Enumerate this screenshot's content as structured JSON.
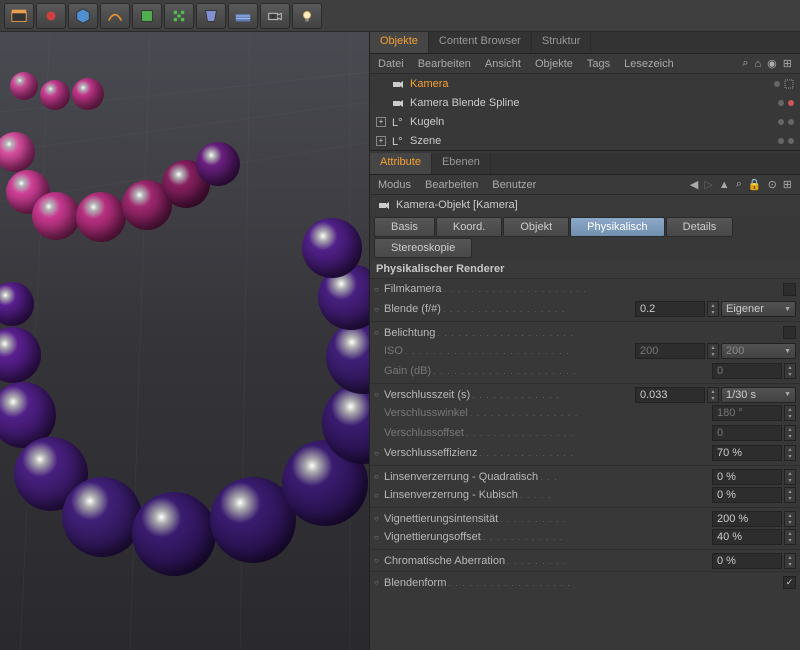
{
  "topTabs": {
    "t1": "Objekte",
    "t2": "Content Browser",
    "t3": "Struktur"
  },
  "menu1": {
    "m1": "Datei",
    "m2": "Bearbeiten",
    "m3": "Ansicht",
    "m4": "Objekte",
    "m5": "Tags",
    "m6": "Lesezeich"
  },
  "objects": {
    "o1": "Kamera",
    "o2": "Kamera Blende Spline",
    "o3": "Kugeln",
    "o4": "Szene"
  },
  "attrTabs": {
    "a1": "Attribute",
    "a2": "Ebenen"
  },
  "menu2": {
    "m1": "Modus",
    "m2": "Bearbeiten",
    "m3": "Benutzer"
  },
  "objTitle": "Kamera-Objekt [Kamera]",
  "btabs": {
    "b1": "Basis",
    "b2": "Koord.",
    "b3": "Objekt",
    "b4": "Physikalisch",
    "b5": "Details",
    "b6": "Stereoskopie"
  },
  "groupTitle": "Physikalischer Renderer",
  "p": {
    "filmkamera": "Filmkamera",
    "blende": "Blende (f/#)",
    "blendeV": "0.2",
    "blendeD": "Eigener",
    "belichtung": "Belichtung",
    "iso": "ISO",
    "isoV": "200",
    "isoD": "200",
    "gain": "Gain (dB)",
    "gainV": "0",
    "vz": "Verschlusszeit (s)",
    "vzV": "0.033",
    "vzD": "1/30 s",
    "vw": "Verschlusswinkel",
    "vwV": "180 °",
    "vo": "Verschlussoffset",
    "voV": "0",
    "ve": "Verschlusseffizienz",
    "veV": "70 %",
    "lq": "Linsenverzerrung - Quadratisch",
    "lqV": "0 %",
    "lk": "Linsenverzerrung - Kubisch",
    "lkV": "0 %",
    "vi": "Vignettierungsintensität",
    "viV": "200 %",
    "vof": "Vignettierungsoffset",
    "vofV": "40 %",
    "ca": "Chromatische Aberration",
    "caV": "0 %",
    "bf": "Blendenform"
  }
}
